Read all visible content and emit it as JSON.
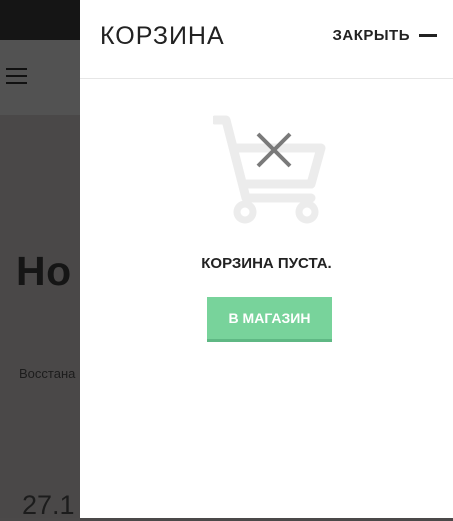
{
  "background": {
    "title": "Ho",
    "text": "Восстана",
    "date": "27.1"
  },
  "cart": {
    "title": "КОРЗИНА",
    "close_label": "ЗАКРЫТЬ",
    "empty_message": "КОРЗИНА ПУСТА.",
    "shop_button_label": "В МАГАЗИН",
    "icons": {
      "close": "minus-icon",
      "empty_cart": "cart-x-icon",
      "menu": "hamburger-icon"
    },
    "colors": {
      "accent": "#78d39b",
      "overlay": "#4b4949"
    }
  }
}
